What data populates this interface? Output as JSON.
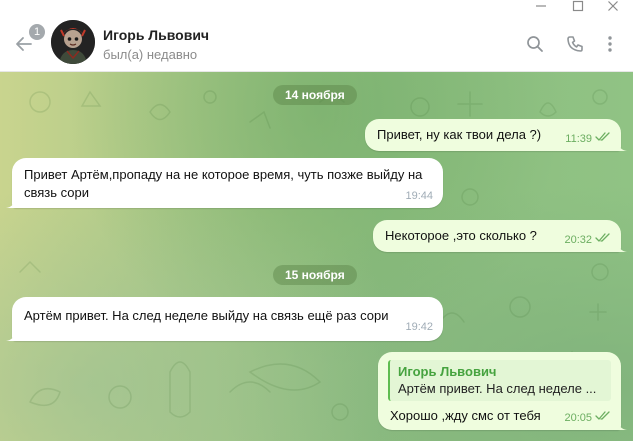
{
  "window": {
    "controls": [
      "minimize-icon",
      "maximize-icon",
      "close-icon"
    ]
  },
  "header": {
    "unread_count": "1",
    "contact_name": "Игорь Львович",
    "status": "был(а) недавно",
    "icons": [
      "back-arrow-icon",
      "search-icon",
      "phone-icon",
      "more-vertical-icon"
    ]
  },
  "chat": {
    "date_1": "14 ноября",
    "date_2": "15 ноября",
    "messages": [
      {
        "direction": "out",
        "text": "Привет, ну как твои дела ?)",
        "time": "11:39",
        "read": true
      },
      {
        "direction": "in",
        "text": "Привет Артём,пропаду на не которое время, чуть позже выйду на связь сори",
        "time": "19:44"
      },
      {
        "direction": "out",
        "text": "Некоторое ,это сколько ?",
        "time": "20:32",
        "read": true
      },
      {
        "direction": "in",
        "text": "Артём привет. На след неделе выйду на связь ещё раз сори",
        "time": "19:42"
      },
      {
        "direction": "out",
        "reply_name": "Игорь Львович",
        "reply_text": "Артём привет. На след неделе ...",
        "text": "Хорошо ,жду смс от тебя",
        "time": "20:05",
        "read": true
      }
    ]
  },
  "colors": {
    "out_bubble": "#effdde",
    "in_bubble": "#ffffff",
    "accent_green": "#5fbd51",
    "date_pill": "rgba(92,130,70,0.45)"
  }
}
